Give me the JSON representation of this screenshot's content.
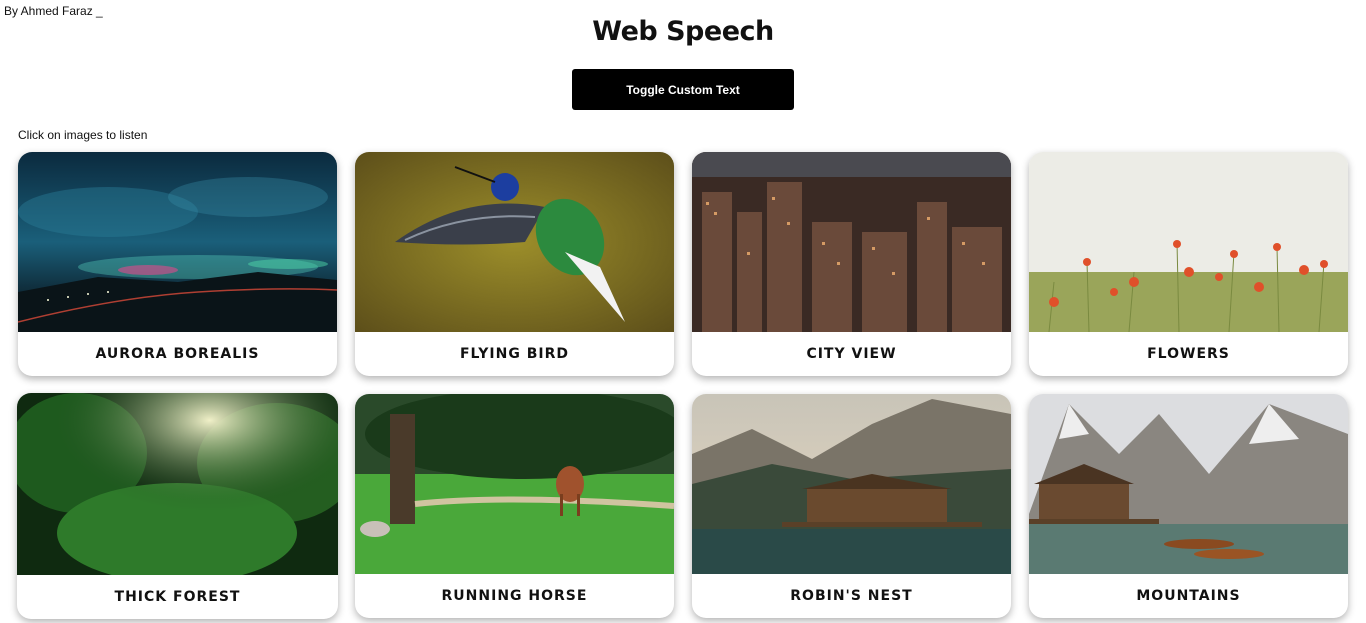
{
  "byline": "By Ahmed Faraz _",
  "title": "Web Speech",
  "toggle_button": "Toggle Custom Text",
  "hint": "Click on images to listen",
  "cards": [
    {
      "label": "AURORA BOREALIS"
    },
    {
      "label": "FLYING BIRD"
    },
    {
      "label": "CITY VIEW"
    },
    {
      "label": "FLOWERS"
    },
    {
      "label": "THICK FOREST"
    },
    {
      "label": "RUNNING HORSE"
    },
    {
      "label": "ROBIN'S NEST"
    },
    {
      "label": "MOUNTAINS"
    }
  ]
}
